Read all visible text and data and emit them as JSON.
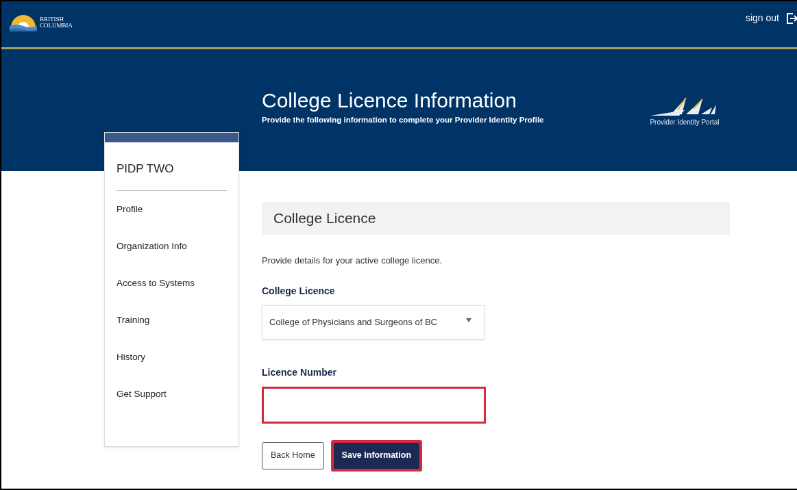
{
  "header": {
    "logo_text": "BRITISH COLUMBIA",
    "sign_out": "sign out"
  },
  "banner": {
    "title": "College Licence Information",
    "subtitle": "Provide the following information to complete your Provider Identity Profile",
    "portal_name": "Provider Identity Portal"
  },
  "sidebar": {
    "title": "PIDP TWO",
    "items": [
      "Profile",
      "Organization Info",
      "Access to Systems",
      "Training",
      "History",
      "Get Support"
    ]
  },
  "section": {
    "heading": "College Licence",
    "description": "Provide details for your active college licence.",
    "fields": [
      {
        "kind": "select",
        "label": "College Licence",
        "value": "College of Physicians and Surgeons of BC",
        "highlighted": false
      },
      {
        "kind": "text",
        "label": "Licence Number",
        "highlighted": true
      }
    ],
    "buttons": [
      {
        "label": "Back Home",
        "primary": false,
        "highlighted": false
      },
      {
        "label": "Save Information",
        "primary": true,
        "highlighted": true
      }
    ]
  }
}
